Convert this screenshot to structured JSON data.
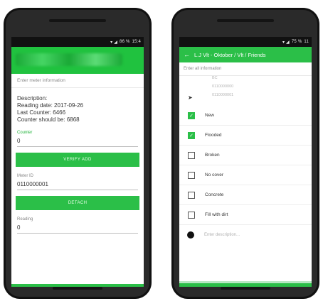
{
  "left_phone": {
    "status": {
      "icons": "▾ ◢",
      "battery": "86 %",
      "time": "15:4"
    },
    "hint": "Enter meter information",
    "description": {
      "label": "Description:",
      "line1": "Reading date: 2017-09-26",
      "line2": "Last Counter: 6466",
      "line3": "Counter should be: 6868"
    },
    "counter_label": "Counter",
    "counter_value": "0",
    "verify_button": "VERIFY ADD",
    "meter_id_label": "Meter ID",
    "meter_id_value": "0110000001",
    "detach_button": "DETACH",
    "reading_label": "Reading",
    "reading_value": "0"
  },
  "right_phone": {
    "status": {
      "icons": "▾ ◢",
      "battery": "75 %",
      "time": "11"
    },
    "title": "L.J Vlt - Oktober / Vlt / Friends",
    "hint": "Enter all information",
    "values": {
      "top": "BC",
      "v1": "0110000000",
      "v2": "0110000001"
    },
    "options": [
      {
        "label": "New",
        "checked": true
      },
      {
        "label": "Flooded",
        "checked": true
      },
      {
        "label": "Broken",
        "checked": false
      },
      {
        "label": "No cover",
        "checked": false
      },
      {
        "label": "Concrete",
        "checked": false
      },
      {
        "label": "Fill with dirt",
        "checked": false
      }
    ],
    "description_placeholder": "Enter description...",
    "accent_color": "#2bbf48"
  }
}
